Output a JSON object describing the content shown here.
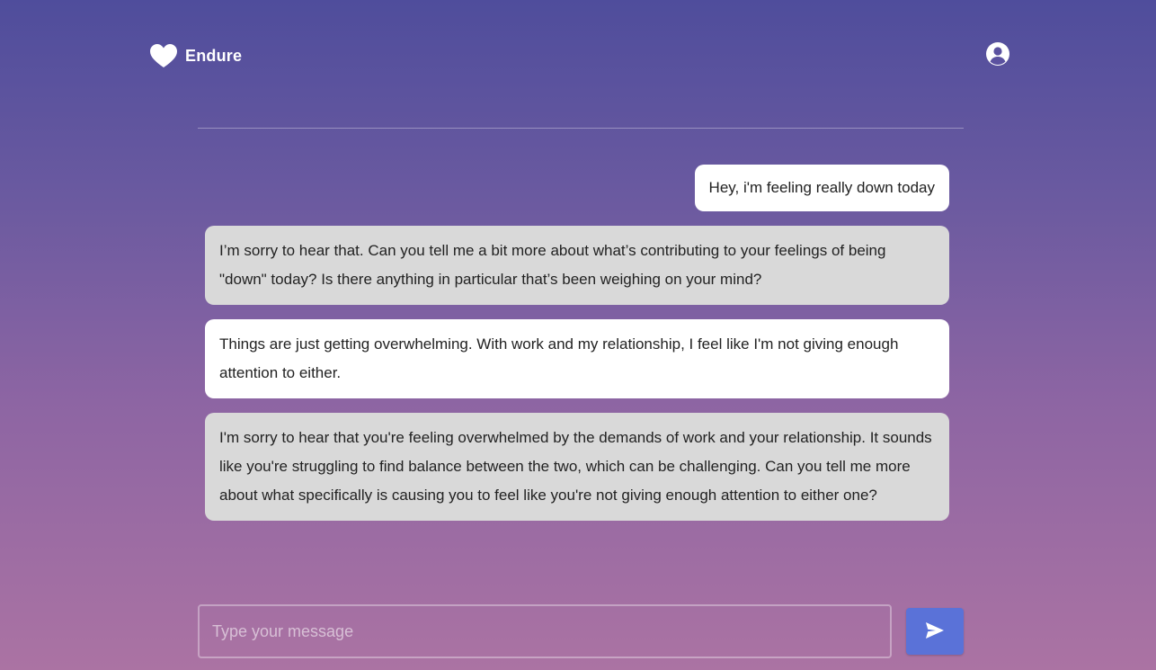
{
  "app": {
    "name": "Endure"
  },
  "icons": {
    "logo": "heart-icon",
    "profile": "user-circle-icon",
    "send": "send-icon"
  },
  "colors": {
    "accent": "#5a72d8",
    "user_bubble": "#ffffff",
    "assistant_bubble": "#d9d9d9"
  },
  "messages": [
    {
      "role": "user",
      "text": "Hey, i'm feeling really down today"
    },
    {
      "role": "assistant",
      "text": "I’m sorry to hear that. Can you tell me a bit more about what’s contributing to your feelings of being \"down\" today? Is there anything in particular that’s been weighing on your mind?"
    },
    {
      "role": "user",
      "text": "Things are just getting overwhelming. With work and my relationship, I feel like I'm not giving enough attention to either."
    },
    {
      "role": "assistant",
      "text": "I'm sorry to hear that you're feeling overwhelmed by the demands of work and your relationship. It sounds like you're struggling to find balance between the two, which can be challenging. Can you tell me more about what specifically is causing you to feel like you're not giving enough attention to either one?"
    }
  ],
  "composer": {
    "placeholder": "Type your message",
    "value": ""
  }
}
